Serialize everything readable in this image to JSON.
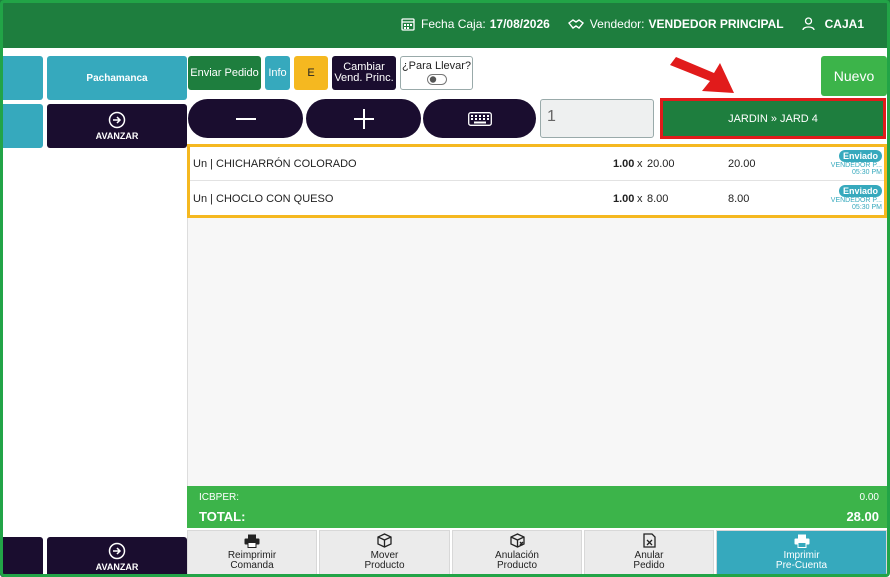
{
  "header": {
    "fecha_label": "Fecha Caja:",
    "fecha_value": "17/08/2026",
    "vendedor_label": "Vendedor:",
    "vendedor_value": "VENDEDOR PRINCIPAL",
    "caja": "CAJA1"
  },
  "sidebar": {
    "category_label": "Pachamanca",
    "avanzar_top": "AVANZAR",
    "avanzar_bottom": "AVANZAR"
  },
  "toolbar": {
    "enviar_pedido": "Enviar Pedido",
    "info": "Info",
    "e_button": "E",
    "cambiar_line1": "Cambiar",
    "cambiar_line2": "Vend. Princ.",
    "para_llevar": "¿Para Llevar?",
    "nuevo": "Nuevo"
  },
  "quantity_value": "1",
  "table_location": "JARDIN » JARD 4",
  "orders": [
    {
      "unit": "Un",
      "name": "CHICHARRÓN COLORADO",
      "qty": "1.00",
      "price": "20.00",
      "total": "20.00",
      "status": "Enviado",
      "vendor": "VENDEDOR P...",
      "time": "05:30 PM"
    },
    {
      "unit": "Un",
      "name": "CHOCLO CON QUESO",
      "qty": "1.00",
      "price": "8.00",
      "total": "8.00",
      "status": "Enviado",
      "vendor": "VENDEDOR P...",
      "time": "05:30 PM"
    }
  ],
  "totals": {
    "icbper_label": "ICBPER:",
    "icbper_value": "0.00",
    "total_label": "TOTAL:",
    "total_value": "28.00"
  },
  "actions": {
    "reimprimir_1": "Reimprimir",
    "reimprimir_2": "Comanda",
    "mover_1": "Mover",
    "mover_2": "Producto",
    "anulacion_1": "Anulación",
    "anulacion_2": "Producto",
    "anular_1": "Anular",
    "anular_2": "Pedido",
    "imprimir_1": "Imprimir",
    "imprimir_2": "Pre-Cuenta"
  },
  "colors": {
    "header_green": "#1e7e3e",
    "accent_green": "#3cb44a",
    "teal": "#36a9bd",
    "navy": "#1a0d2f",
    "yellow": "#f5b820",
    "highlight_red": "#e11b1b"
  }
}
